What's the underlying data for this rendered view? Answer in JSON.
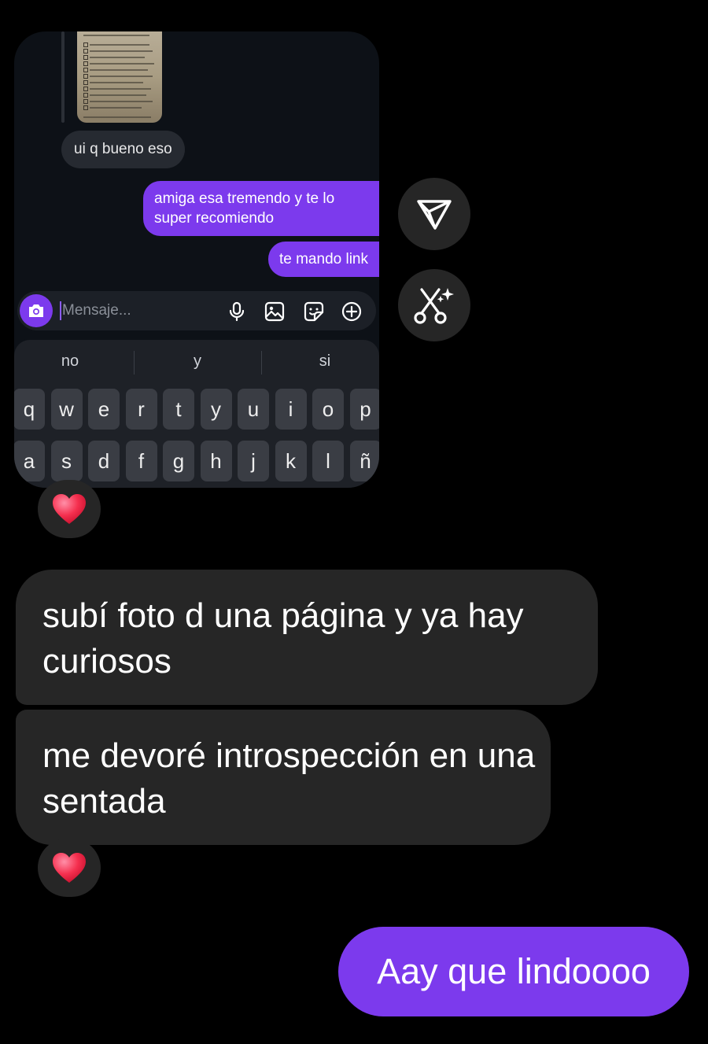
{
  "screenshot": {
    "received_reply": "ui q bueno eso",
    "sent_messages": [
      "amiga esa tremendo y te lo super recomiendo",
      "te mando link"
    ],
    "composer": {
      "placeholder": "Mensaje..."
    },
    "keyboard": {
      "suggestions": [
        "no",
        "y",
        "si"
      ],
      "row1": [
        "q",
        "w",
        "e",
        "r",
        "t",
        "y",
        "u",
        "i",
        "o",
        "p"
      ],
      "row2": [
        "a",
        "s",
        "d",
        "f",
        "g",
        "h",
        "j",
        "k",
        "l",
        "ñ"
      ]
    }
  },
  "actions": {
    "share_icon": "paper-plane-icon",
    "ai_icon": "scissors-sparkle-icon"
  },
  "messages": {
    "incoming": [
      "subí foto d una página y ya hay curiosos",
      "me devoré introspección en una sentada"
    ],
    "outgoing": "Aay que lindoooo"
  },
  "reactions": {
    "emoji": "heart"
  },
  "colors": {
    "accent": "#7c3aed",
    "bubble_in": "#262626",
    "background": "#000000"
  }
}
